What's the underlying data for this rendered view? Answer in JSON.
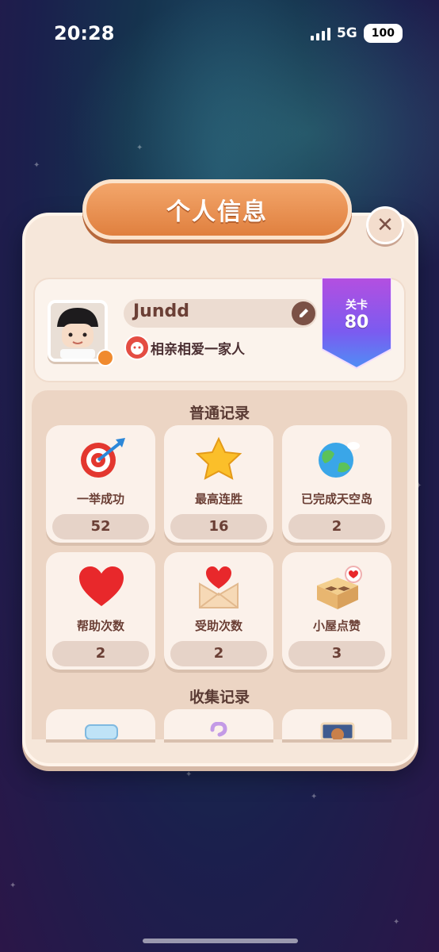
{
  "status_bar": {
    "time": "20:28",
    "network": "5G",
    "battery": "100"
  },
  "dialog": {
    "title": "个人信息"
  },
  "profile": {
    "name": "Jundd",
    "family": "相亲相爱一家人",
    "level_label": "关卡",
    "level_value": "80"
  },
  "normal_records": {
    "title": "普通记录",
    "items": [
      {
        "label": "一举成功",
        "value": "52",
        "icon": "target-arrow-icon"
      },
      {
        "label": "最高连胜",
        "value": "16",
        "icon": "star-icon"
      },
      {
        "label": "已完成天空岛",
        "value": "2",
        "icon": "planet-icon"
      },
      {
        "label": "帮助次数",
        "value": "2",
        "icon": "heart-icon"
      },
      {
        "label": "受助次数",
        "value": "2",
        "icon": "heart-letter-icon"
      },
      {
        "label": "小屋点赞",
        "value": "3",
        "icon": "house-like-icon"
      }
    ]
  },
  "collection_records": {
    "title": "收集记录"
  },
  "colors": {
    "accent": "#e0803f",
    "panel": "#f6e7da",
    "level_ribbon": "#8a55e3"
  }
}
